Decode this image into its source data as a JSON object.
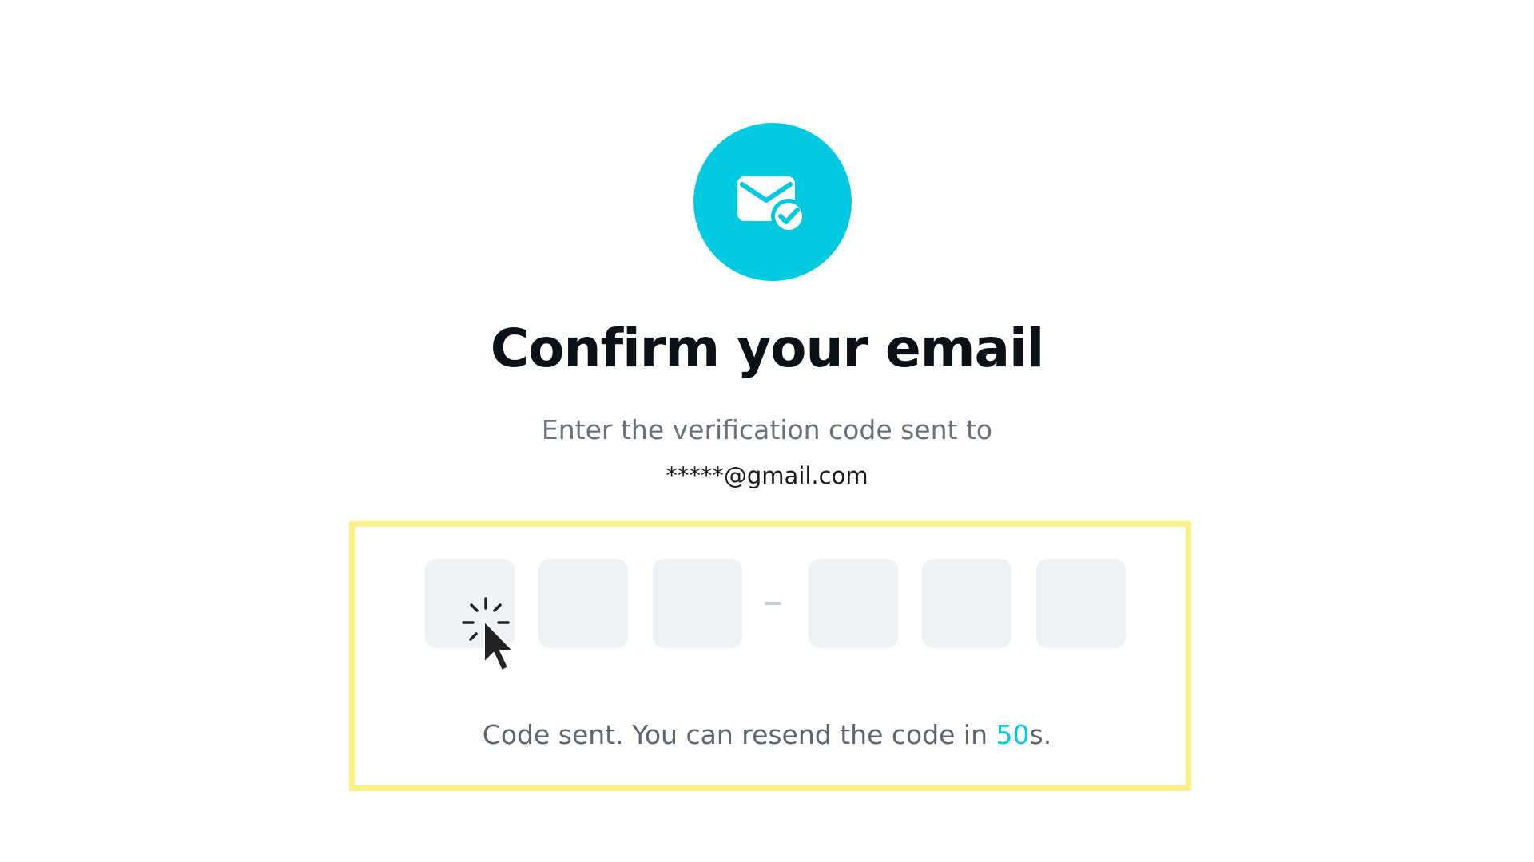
{
  "header": {
    "icon": "mail-check-icon",
    "title": "Confirm your email",
    "subtitle": "Enter the verification code sent to",
    "email": "*****@gmail.com"
  },
  "code_input": {
    "boxes": [
      "",
      "",
      "",
      "",
      "",
      ""
    ],
    "separator": "-"
  },
  "resend": {
    "prefix": "Code sent. You can resend the code in ",
    "countdown": "50",
    "suffix": "s."
  },
  "colors": {
    "accent": "#00c9e0",
    "highlight": "#fbf184",
    "box_background": "#eff2f5",
    "title": "#0c1118",
    "muted_text": "#6b727c"
  },
  "cursor": {
    "icon": "click-cursor-icon"
  }
}
